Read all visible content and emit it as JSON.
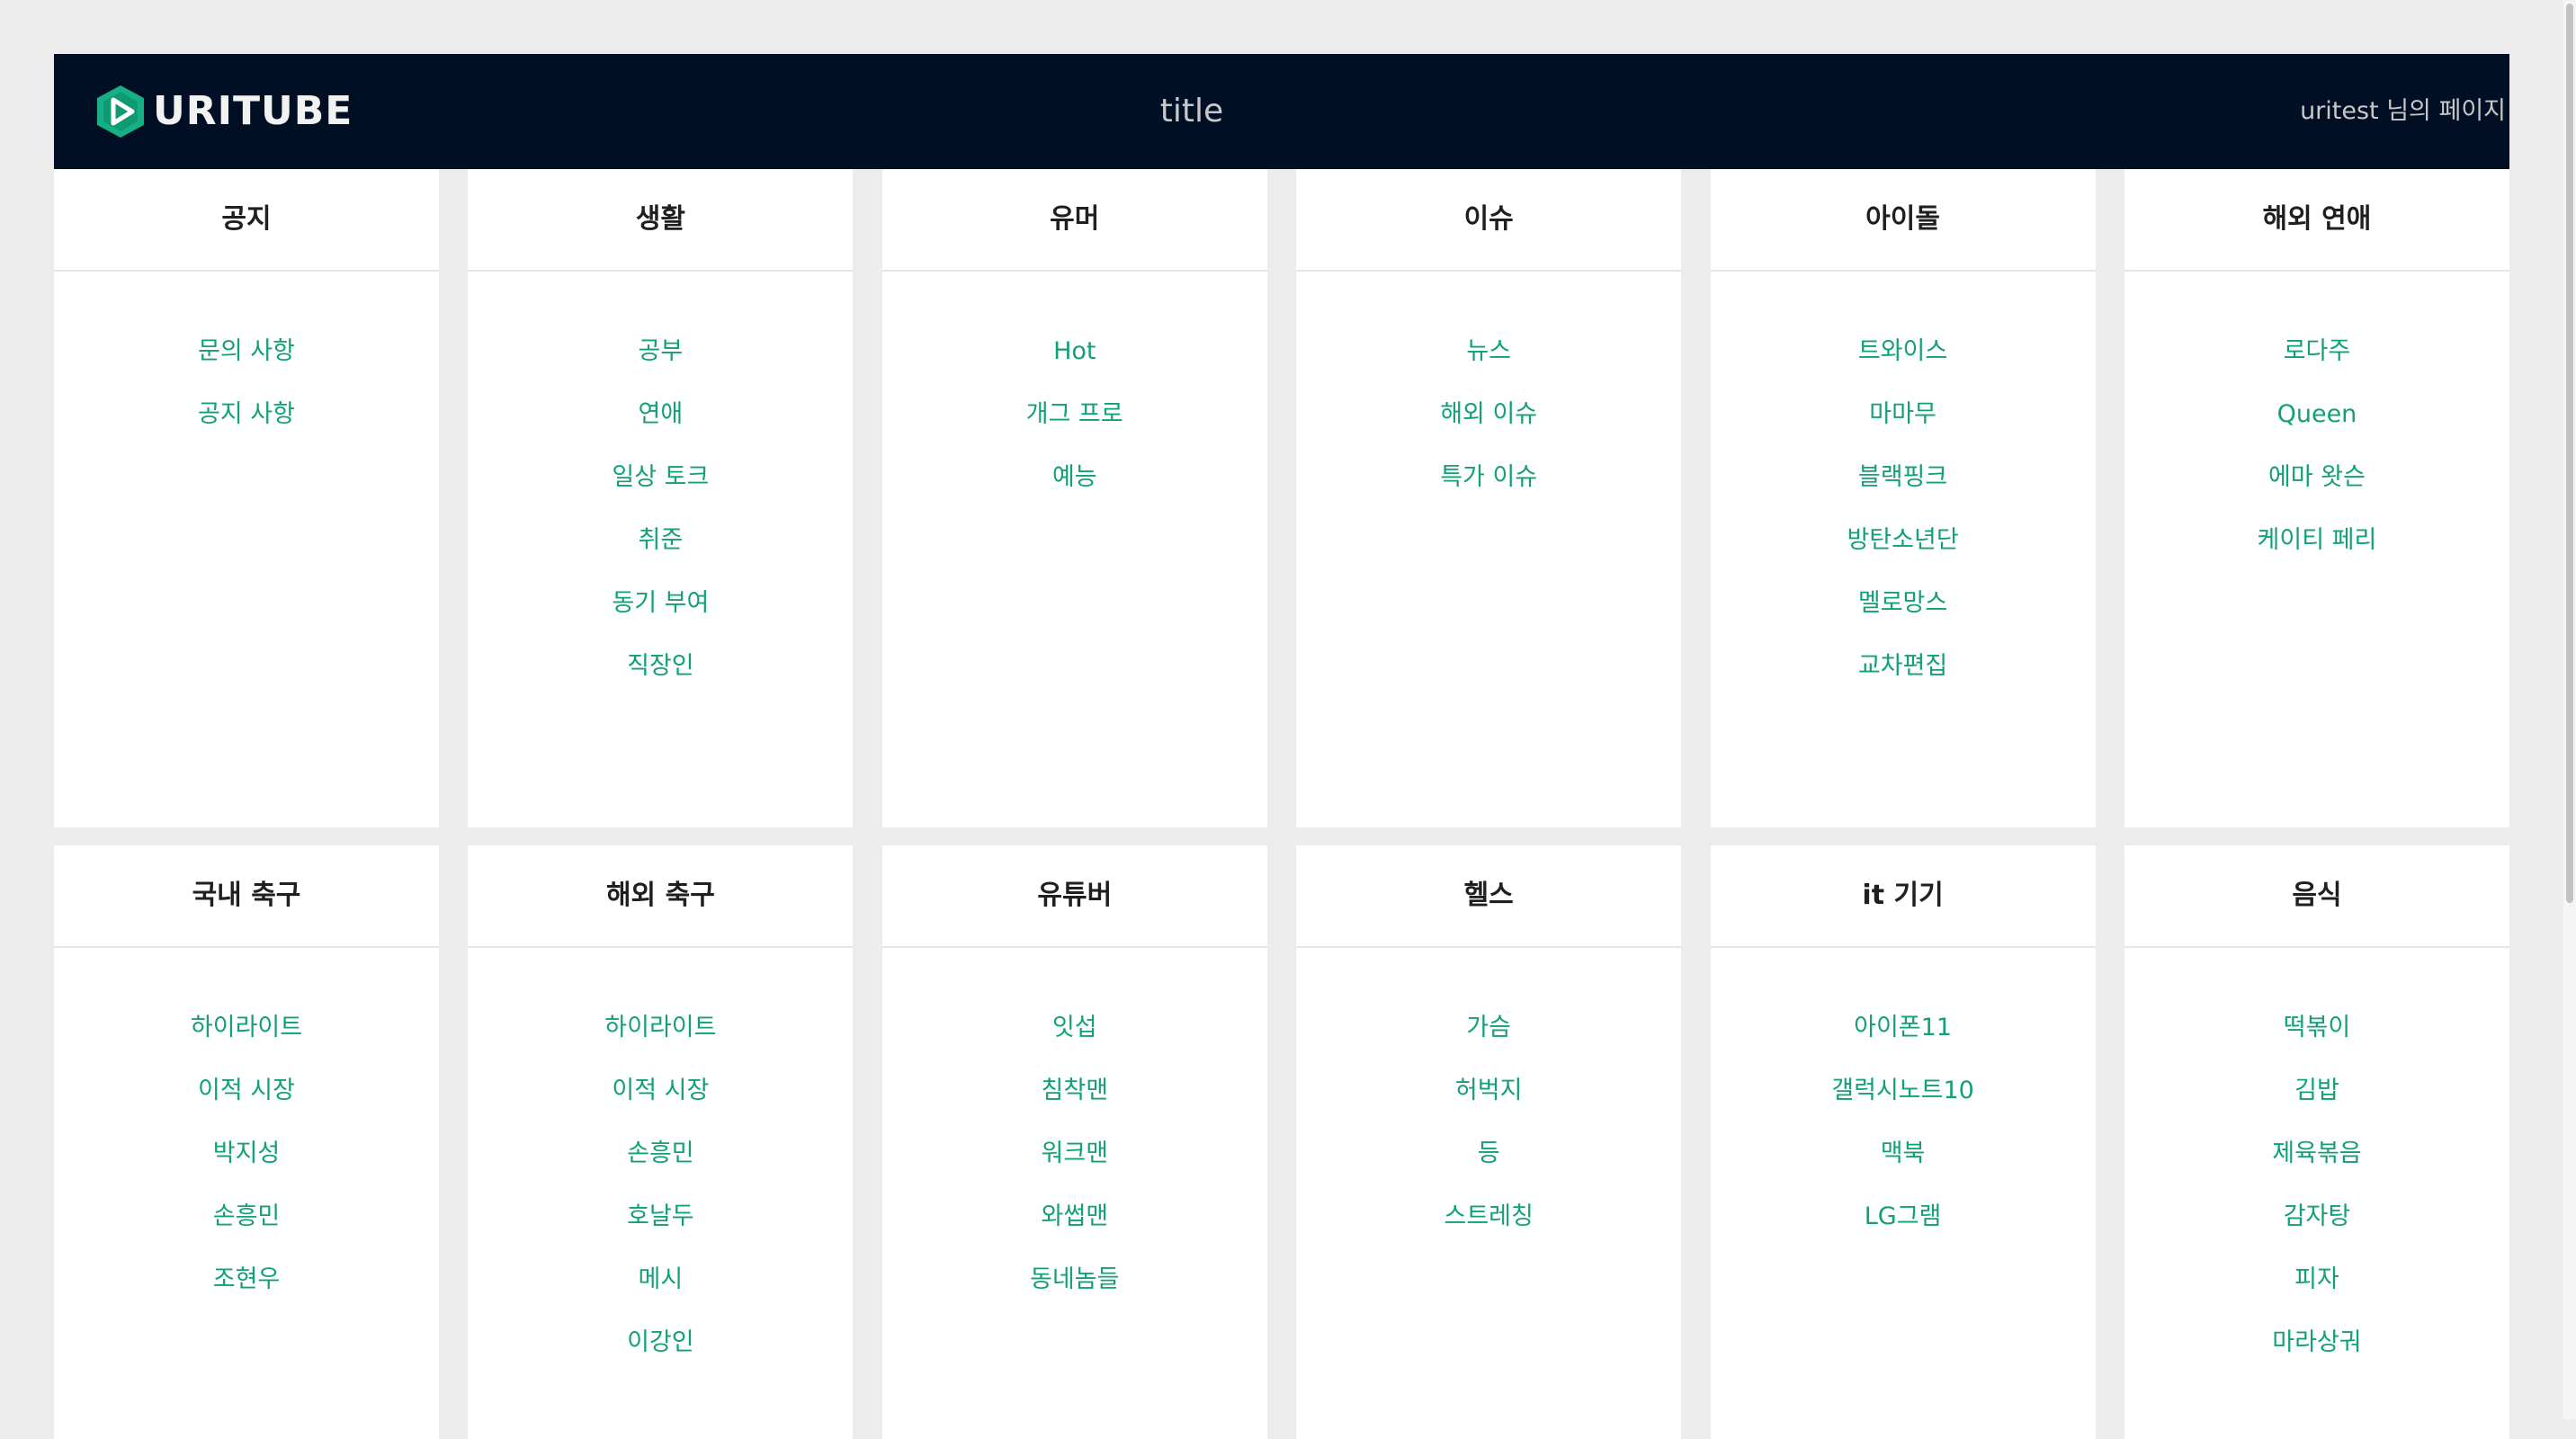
{
  "header": {
    "logo_text": "URITUBE",
    "title": "title",
    "user_link": "uritest 님의 페이지"
  },
  "colors": {
    "header_bg": "#010f24",
    "page_bg": "#ececec",
    "link": "#12a078",
    "logo_green": "#17b085"
  },
  "categories": [
    {
      "title": "공지",
      "items": [
        "문의 사항",
        "공지 사항"
      ]
    },
    {
      "title": "생활",
      "items": [
        "공부",
        "연애",
        "일상 토크",
        "취준",
        "동기 부여",
        "직장인"
      ]
    },
    {
      "title": "유머",
      "items": [
        "Hot",
        "개그 프로",
        "예능"
      ]
    },
    {
      "title": "이슈",
      "items": [
        "뉴스",
        "해외 이슈",
        "특가 이슈"
      ]
    },
    {
      "title": "아이돌",
      "items": [
        "트와이스",
        "마마무",
        "블랙핑크",
        "방탄소년단",
        "멜로망스",
        "교차편집"
      ]
    },
    {
      "title": "해외 연애",
      "items": [
        "로다주",
        "Queen",
        "에마 왓슨",
        "케이티 페리"
      ]
    },
    {
      "title": "국내 축구",
      "items": [
        "하이라이트",
        "이적 시장",
        "박지성",
        "손흥민",
        "조현우"
      ]
    },
    {
      "title": "해외 축구",
      "items": [
        "하이라이트",
        "이적 시장",
        "손흥민",
        "호날두",
        "메시",
        "이강인"
      ]
    },
    {
      "title": "유튜버",
      "items": [
        "잇섭",
        "침착맨",
        "워크맨",
        "와썹맨",
        "동네놈들"
      ]
    },
    {
      "title": "헬스",
      "items": [
        "가슴",
        "허벅지",
        "등",
        "스트레칭"
      ]
    },
    {
      "title": "it 기기",
      "items": [
        "아이폰11",
        "갤럭시노트10",
        "맥북",
        "LG그램"
      ]
    },
    {
      "title": "음식",
      "items": [
        "떡볶이",
        "김밥",
        "제육볶음",
        "감자탕",
        "피자",
        "마라상궈"
      ]
    }
  ]
}
